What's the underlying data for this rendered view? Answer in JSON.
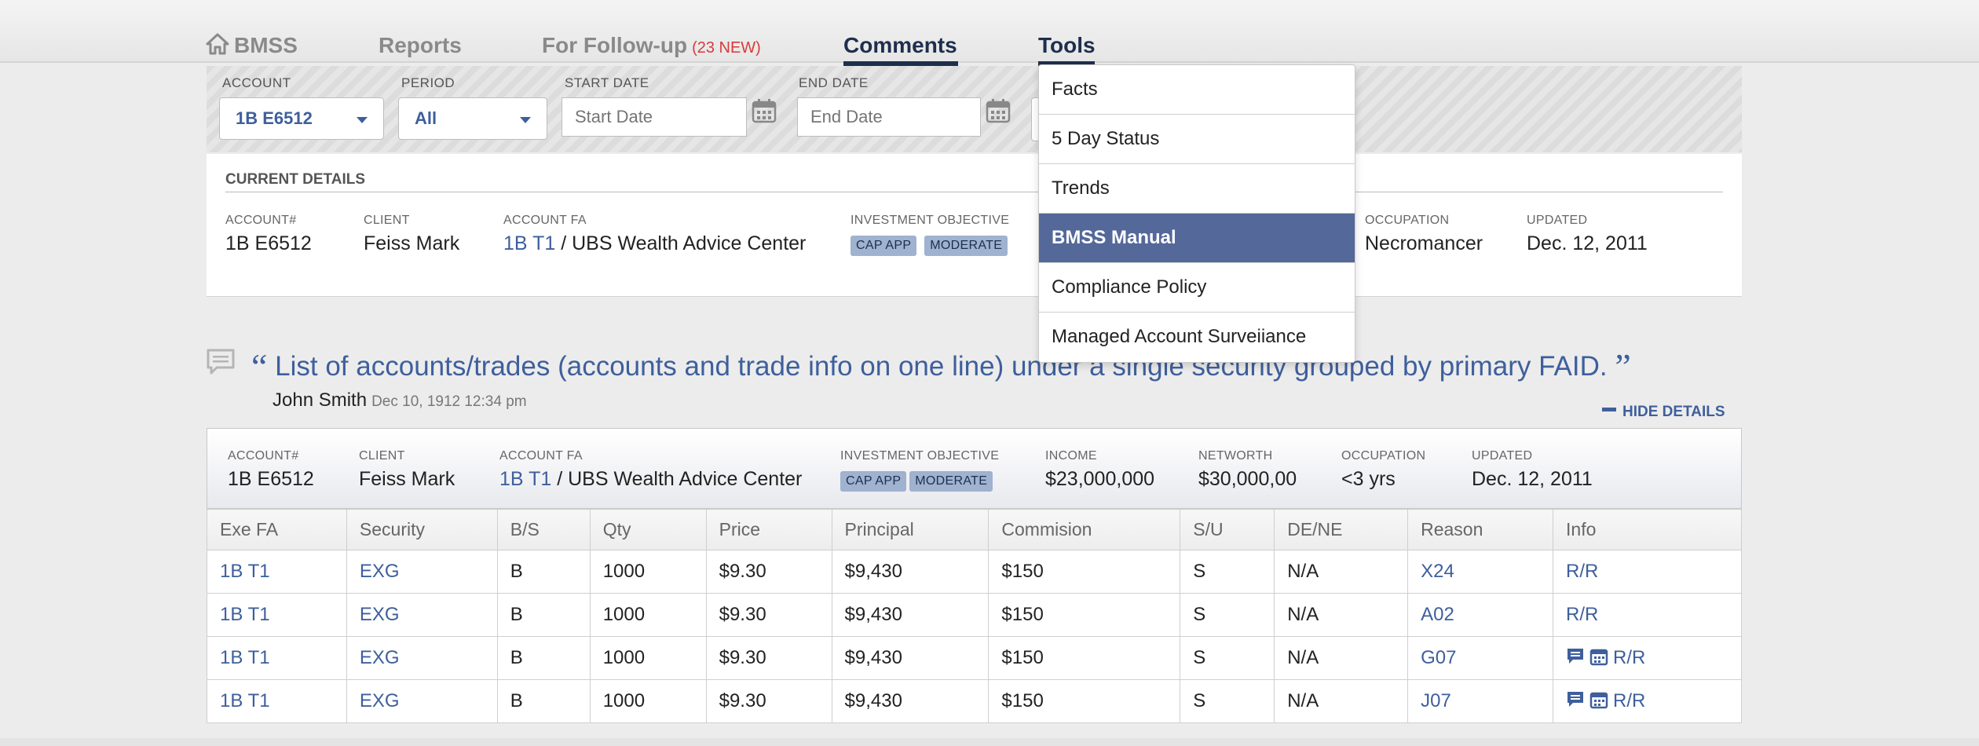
{
  "nav": {
    "home_label": "BMSS",
    "reports_label": "Reports",
    "followup_label": "For Follow-up",
    "followup_badge": "(23 NEW)",
    "comments_label": "Comments",
    "tools_label": "Tools"
  },
  "filters": {
    "account_label": "ACCOUNT",
    "account_value": "1B E6512",
    "period_label": "PERIOD",
    "period_value": "All",
    "start_label": "START DATE",
    "start_placeholder": "Start Date",
    "end_label": "END DATE",
    "end_placeholder": "End Date"
  },
  "current": {
    "title": "CURRENT DETAILS",
    "account_label": "ACCOUNT#",
    "account_value": "1B E6512",
    "client_label": "CLIENT",
    "client_value": "Feiss Mark",
    "fa_label": "ACCOUNT FA",
    "fa_code": "1B T1",
    "fa_name": "/ UBS Wealth Advice Center",
    "objective_label": "INVESTMENT OBJECTIVE",
    "tag1": "CAP APP",
    "tag2": "MODERATE",
    "occupation_label": "OCCUPATION",
    "occupation_value": "Necromancer",
    "updated_label": "UPDATED",
    "updated_value": "Dec. 12, 2011"
  },
  "comment": {
    "open_quote": "“",
    "text": "List of accounts/trades (accounts and trade info on one line) under a single security grouped by primary FAID.",
    "close_quote": "”",
    "author": "John Smith",
    "date": "Dec 10, 1912 12:34 pm",
    "hide_label": "HIDE DETAILS"
  },
  "history": {
    "account_label": "ACCOUNT#",
    "account_value": "1B E6512",
    "client_label": "CLIENT",
    "client_value": "Feiss Mark",
    "fa_label": "ACCOUNT FA",
    "fa_code": "1B T1",
    "fa_name": "/ UBS Wealth Advice Center",
    "objective_label": "INVESTMENT OBJECTIVE",
    "tag1": "CAP APP",
    "tag2": "MODERATE",
    "income_label": "INCOME",
    "income_value": "$23,000,000",
    "networth_label": "NETWORTH",
    "networth_value": "$30,000,00",
    "occupation_label": "OCCUPATION",
    "occupation_value": "<3 yrs",
    "updated_label": "UPDATED",
    "updated_value": "Dec. 12, 2011"
  },
  "table": {
    "headers": [
      "Exe FA",
      "Security",
      "B/S",
      "Qty",
      "Price",
      "Principal",
      "Commision",
      "S/U",
      "DE/NE",
      "Reason",
      "Info"
    ],
    "rows": [
      {
        "exe": "1B T1",
        "sec": "EXG",
        "bs": "B",
        "qty": "1000",
        "price": "$9.30",
        "principal": "$9,430",
        "comm": "$150",
        "su": "S",
        "dene": "N/A",
        "reason": "X24",
        "info": "R/R"
      },
      {
        "exe": "1B T1",
        "sec": "EXG",
        "bs": "B",
        "qty": "1000",
        "price": "$9.30",
        "principal": "$9,430",
        "comm": "$150",
        "su": "S",
        "dene": "N/A",
        "reason": "A02",
        "info": "R/R"
      },
      {
        "exe": "1B T1",
        "sec": "EXG",
        "bs": "B",
        "qty": "1000",
        "price": "$9.30",
        "principal": "$9,430",
        "comm": "$150",
        "su": "S",
        "dene": "N/A",
        "reason": "G07",
        "info": "R/R"
      },
      {
        "exe": "1B T1",
        "sec": "EXG",
        "bs": "B",
        "qty": "1000",
        "price": "$9.30",
        "principal": "$9,430",
        "comm": "$150",
        "su": "S",
        "dene": "N/A",
        "reason": "J07",
        "info": "R/R"
      }
    ]
  },
  "tools_menu": {
    "items": [
      "Facts",
      "5 Day Status",
      "Trends",
      "BMSS Manual",
      "Compliance Policy",
      "Managed Account Surveiiance"
    ],
    "selected": "BMSS Manual"
  },
  "colors": {
    "accent": "#3e5f9c",
    "nav_active": "#1e2f4d",
    "badge": "#d83a3a",
    "menu_selected": "#54689a",
    "tag_bg": "#9fb2cf"
  },
  "icons": [
    "home-icon",
    "chevron-down-icon",
    "calendar-icon",
    "comment-icon",
    "minus-icon"
  ]
}
